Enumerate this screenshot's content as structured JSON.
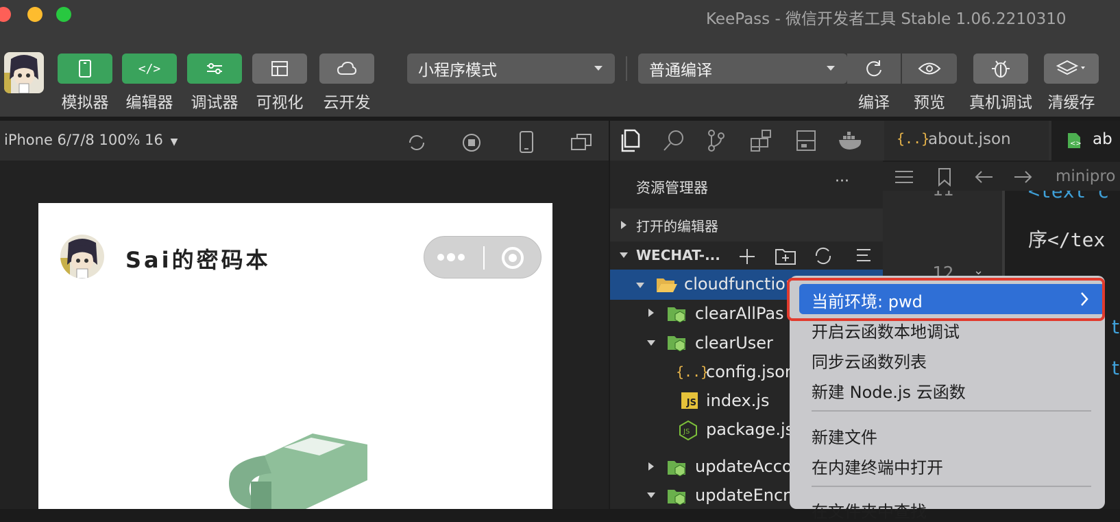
{
  "window": {
    "title": "KeePass - 微信开发者工具 Stable 1.06.2210310",
    "traffic_colors": [
      "#fe5f57",
      "#febc2e",
      "#28c840"
    ]
  },
  "toolbar": {
    "left_buttons": [
      {
        "label": "模拟器",
        "icon": "phone-icon"
      },
      {
        "label": "编辑器",
        "icon": "code-icon"
      },
      {
        "label": "调试器",
        "icon": "sliders-icon"
      },
      {
        "label": "可视化",
        "icon": "layout-icon"
      },
      {
        "label": "云开发",
        "icon": "cloud-icon"
      }
    ],
    "mode_select": "小程序模式",
    "compile_select": "普通编译",
    "right_buttons": [
      {
        "label": "编译",
        "icon": "refresh-icon"
      },
      {
        "label": "预览",
        "icon": "eye-icon"
      },
      {
        "label": "真机调试",
        "icon": "bug-icon"
      },
      {
        "label": "清缓存",
        "icon": "layers-icon"
      }
    ]
  },
  "simulator": {
    "device": "iPhone 6/7/8 100% 16",
    "app_title": "Sai的密码本"
  },
  "explorer": {
    "title": "资源管理器",
    "open_editors": "打开的编辑器",
    "workspace": "WECHAT-...",
    "tree": [
      {
        "label": "cloudfunction",
        "type": "folder-open"
      },
      {
        "label": "clearAllPas",
        "type": "folder-green"
      },
      {
        "label": "clearUser",
        "type": "folder-green-open"
      },
      {
        "label": "config.json",
        "type": "json"
      },
      {
        "label": "index.js",
        "type": "js"
      },
      {
        "label": "package.js",
        "type": "node"
      },
      {
        "label": "updateAcco",
        "type": "folder-green"
      },
      {
        "label": "updateEncr",
        "type": "folder-green-open"
      }
    ]
  },
  "editor": {
    "tabs": [
      {
        "label": "about.json"
      },
      {
        "label": "ab"
      }
    ],
    "breadcrumb": "minipro",
    "line_numbers": [
      "11",
      "12"
    ],
    "code_lines": [
      "<text c",
      "序</tex"
    ]
  },
  "context_menu": {
    "highlighted": "当前环境: pwd",
    "items_group1": [
      "开启云函数本地调试",
      "同步云函数列表",
      "新建 Node.js 云函数"
    ],
    "items_group2": [
      "新建文件",
      "在内建终端中打开"
    ],
    "items_group3": [
      "在文件夹中查找"
    ]
  }
}
